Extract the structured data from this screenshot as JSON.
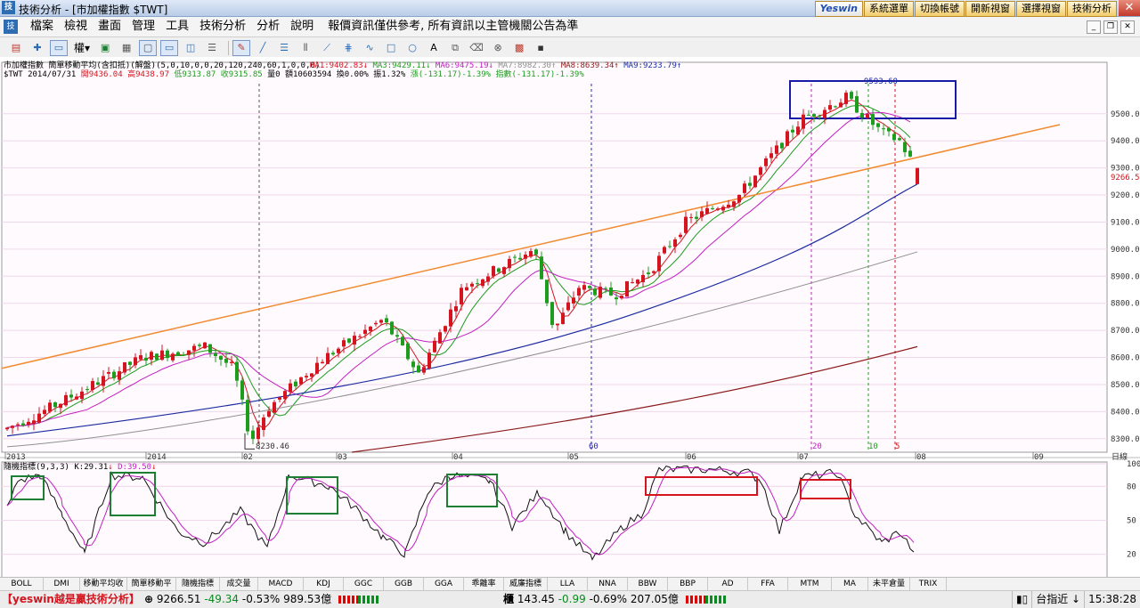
{
  "window": {
    "title": "技術分析 - [市加權指數 $TWT]",
    "brand": "Yeswin",
    "top_buttons": [
      "系統選單",
      "切換帳號",
      "開新視窗",
      "選擇視窗",
      "技術分析"
    ],
    "close": "✕"
  },
  "menubar": {
    "items": [
      "檔案",
      "檢視",
      "畫面",
      "管理",
      "工具",
      "技術分析",
      "分析",
      "說明"
    ],
    "notice": "報價資訊僅供參考, 所有資訊以主管機關公告為準"
  },
  "toolbar": {
    "rights_label": "權"
  },
  "price_chart": {
    "header_line1": {
      "prefix": "市加權指數 簡單移動平均(含扣抵)(解盤)(5,0,10,0,0,20,120,240,60,1,0,0,0)",
      "ma": [
        {
          "label": "MA1:9402.83",
          "arrow": "↓",
          "color": "#d4141e"
        },
        {
          "label": "MA3:9429.11",
          "arrow": "↓",
          "color": "#1e9c1e"
        },
        {
          "label": "MA6:9475.19",
          "arrow": "↓",
          "color": "#c020c0"
        },
        {
          "label": "MA7:8982.30",
          "arrow": "↑",
          "color": "#909090"
        },
        {
          "label": "MA8:8639.34",
          "arrow": "↑",
          "color": "#8b1a1a"
        },
        {
          "label": "MA9:9233.79",
          "arrow": "↑",
          "color": "#1a2aa0"
        }
      ]
    },
    "header_line2": {
      "symbol": "$TWT 2014/07/31",
      "open": "開9436.04",
      "high": "高9438.97",
      "low": "低9313.87",
      "close": "收9315.85",
      "volume": "量0 額10603594",
      "turnover": "換0.00% 振1.32%",
      "change": "漲(-131.17)-1.39% 指數(-131.17)-1.39%"
    },
    "y_axis": [
      "9500.0",
      "9400.0",
      "9300.0",
      "9200.0",
      "9100.0",
      "9000.0",
      "8900.0",
      "8800.0",
      "8700.0",
      "8600.0",
      "8500.0",
      "8400.0",
      "8300.0"
    ],
    "y_range": [
      8250,
      9690
    ],
    "current_price": "9266.5",
    "x_axis": [
      "2013",
      "2014",
      "02",
      "03",
      "04",
      "05",
      "06",
      "07",
      "08",
      "09"
    ],
    "x_axis_unit": "日線",
    "annotations": {
      "high_label": "9593.60",
      "low_label": "8230.46",
      "cycle_labels": [
        "60",
        "20",
        "10",
        "5"
      ]
    },
    "colors": {
      "up": "#d4141e",
      "down": "#1e9c1e",
      "trendline": "#f28a30",
      "ma60": "#1a2aa0",
      "ma120": "#909090",
      "ma240": "#8b1a1a",
      "box_blue": "#1a1aa8"
    }
  },
  "stochastic": {
    "header": "隨機指標(9,3,3)",
    "k": "K:29.31",
    "k_arrow": "↓",
    "d": "D:39.50",
    "d_arrow": "↓",
    "y_axis": [
      "100",
      "80",
      "50",
      "20"
    ]
  },
  "indicator_tabs": [
    "BOLL",
    "DMI",
    "移動平均收",
    "簡單移動平",
    "隨機指標",
    "成交量",
    "MACD",
    "KDJ",
    "GGC",
    "GGB",
    "GGA",
    "乖離率",
    "威廉指標",
    "LLA",
    "NNA",
    "BBW",
    "BBP",
    "AD",
    "FFA",
    "MTM",
    "MA",
    "未平倉量",
    "TRIX"
  ],
  "status": {
    "slogan": "【yeswin越是贏技術分析】",
    "twse_tag": "⊕",
    "twse_price": "9266.51",
    "twse_change": "-49.34",
    "twse_pct": "-0.53%",
    "twse_amount": "989.53億",
    "otc_tag": "櫃",
    "otc_price": "143.45",
    "otc_change": "-0.99",
    "otc_pct": "-0.69%",
    "otc_amount": "207.05億",
    "index_label": "台指近 ↓",
    "time": "15:38:28"
  }
}
